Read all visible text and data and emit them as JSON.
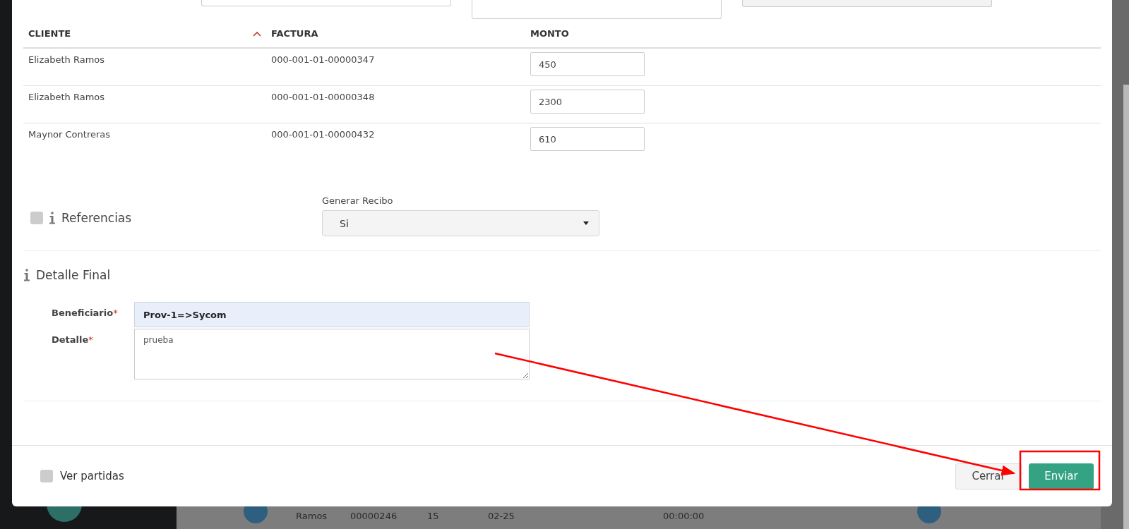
{
  "table": {
    "columns": [
      {
        "label": "CLIENTE",
        "sorted": true
      },
      {
        "label": "FACTURA",
        "sorted": false
      },
      {
        "label": "MONTO",
        "sorted": false
      }
    ],
    "rows": [
      {
        "cliente": "Elizabeth Ramos",
        "factura": "000-001-01-00000347",
        "monto": "450"
      },
      {
        "cliente": "Elizabeth Ramos",
        "factura": "000-001-01-00000348",
        "monto": "2300"
      },
      {
        "cliente": "Maynor Contreras",
        "factura": "000-001-01-00000432",
        "monto": "610"
      }
    ]
  },
  "referencias": {
    "label": "Referencias",
    "checked": false
  },
  "generar_recibo": {
    "label": "Generar Recibo",
    "value": "Si"
  },
  "detalle_final": {
    "title": "Detalle Final",
    "fields": [
      {
        "label": "Beneficiario",
        "required_mark": "*",
        "value": "Prov-1=>Sycom",
        "kind": "input"
      },
      {
        "label": "Detalle",
        "required_mark": "*",
        "value": "prueba",
        "kind": "textarea"
      }
    ]
  },
  "footer": {
    "ver_partidas": {
      "label": "Ver partidas",
      "checked": false
    },
    "buttons": [
      {
        "label": "Cerrar",
        "kind": "secondary"
      },
      {
        "label": "Enviar",
        "kind": "primary"
      }
    ]
  },
  "background_row": [
    "Ramos",
    "00000246",
    "15",
    "02-25",
    "00:00:00"
  ]
}
